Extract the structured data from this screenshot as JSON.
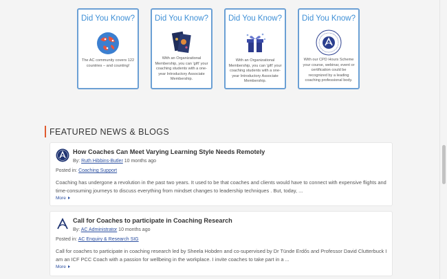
{
  "did_you_know": [
    {
      "title": "Did You Know?",
      "icon": "globe-icon",
      "text": "The AC community covers 122 countries – and counting!"
    },
    {
      "title": "Did You Know?",
      "icon": "membership-cards-icon",
      "text": "With an Organizational Membership, you can 'gift' your coaching students with a one-year Introductory Associate Membership."
    },
    {
      "title": "Did You Know?",
      "icon": "gift-icon",
      "text": "With an Organizational Membership, you can 'gift' your coaching students with a one-year Introductory Associate Membership."
    },
    {
      "title": "Did You Know?",
      "icon": "cpd-seal-icon",
      "text": "With our CPD Hours Scheme your course, webinar, event or certification could be recognized by a leading coaching professional body."
    }
  ],
  "featured": {
    "heading": "FEATURED NEWS & BLOGS"
  },
  "news": [
    {
      "title": "How Coaches Can Meet Varying Learning Style Needs Remotely",
      "by_label": "By:",
      "author": "Ruth Hibbins-Butler",
      "time": "10 months ago",
      "posted_label": "Posted in:",
      "category": "Coaching Support",
      "excerpt": "Coaching has undergone a revolution in the past two years. It used to be that coaches and clients would have to connect with expensive flights and time-consuming journeys to discuss everything from mindset changes to leadership techniques . But, today, ...",
      "more": "More"
    },
    {
      "title": "Call for Coaches to participate in Coaching Research",
      "by_label": "By:",
      "author": "AC Administrator",
      "time": "10 months ago",
      "posted_label": "Posted in:",
      "category": "AC Enquiry & Research SIG",
      "excerpt": "Call for coaches to participate in coaching research led by Sheela Hobden and co-supervised by Dr Tünde Erdős and Professor David Clutterbuck I am an ICF PCC Coach with a passion for wellbeing in the workplace. I invite coaches to take part in a ...",
      "more": "More"
    }
  ],
  "colors": {
    "accent_blue": "#3e8fd6",
    "card_border": "#6a9fd4",
    "link": "#2b4fa0",
    "heading_bar": "#e05a2e"
  }
}
